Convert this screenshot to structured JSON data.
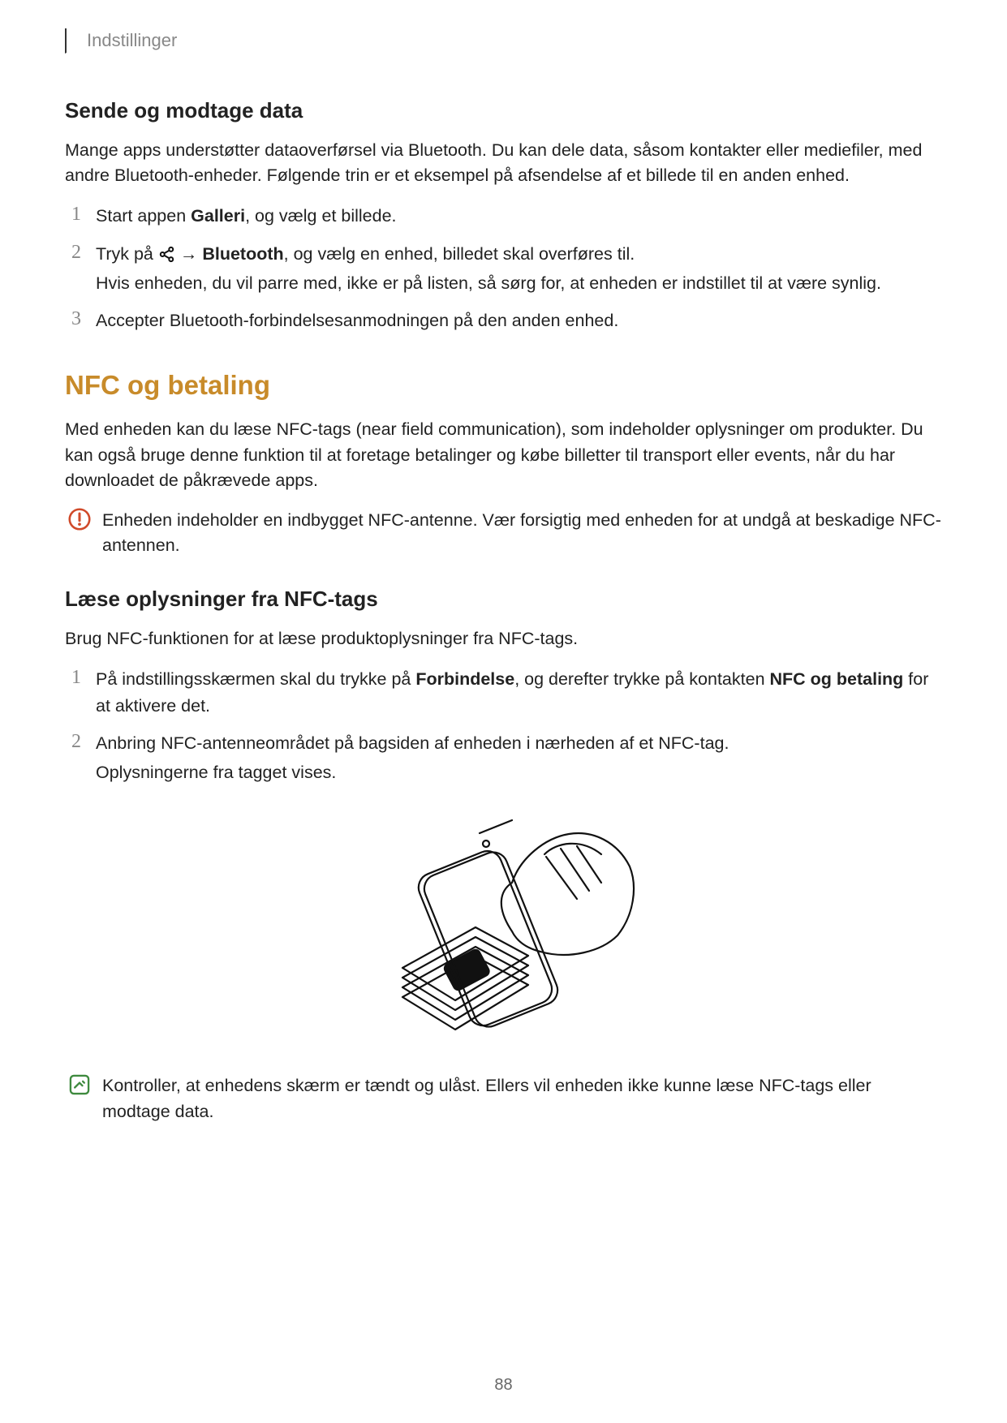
{
  "header": {
    "section": "Indstillinger"
  },
  "sect1": {
    "title": "Sende og modtage data",
    "intro": "Mange apps understøtter dataoverførsel via Bluetooth. Du kan dele data, såsom kontakter eller mediefiler, med andre Bluetooth-enheder. Følgende trin er et eksempel på afsendelse af et billede til en anden enhed.",
    "s1": {
      "num": "1",
      "a": "Start appen ",
      "b": "Galleri",
      "c": ", og vælg et billede."
    },
    "s2": {
      "num": "2",
      "a": "Tryk på ",
      "arrow": " → ",
      "b": "Bluetooth",
      "c": ", og vælg en enhed, billedet skal overføres til.",
      "d": "Hvis enheden, du vil parre med, ikke er på listen, så sørg for, at enheden er indstillet til at være synlig."
    },
    "s3": {
      "num": "3",
      "a": "Accepter Bluetooth-forbindelsesanmodningen på den anden enhed."
    }
  },
  "h2": "NFC og betaling",
  "nfc_intro": "Med enheden kan du læse NFC-tags (near field communication), som indeholder oplysninger om produkter. Du kan også bruge denne funktion til at foretage betalinger og købe billetter til transport eller events, når du har downloadet de påkrævede apps.",
  "warn": "Enheden indeholder en indbygget NFC-antenne. Vær forsigtig med enheden for at undgå at beskadige NFC-antennen.",
  "sect2": {
    "title": "Læse oplysninger fra NFC-tags",
    "intro": "Brug NFC-funktionen for at læse produktoplysninger fra NFC-tags.",
    "s1": {
      "num": "1",
      "a": "På indstillingsskærmen skal du trykke på ",
      "b": "Forbindelse",
      "c": ", og derefter trykke på kontakten ",
      "d": "NFC og betaling",
      "e": " for at aktivere det."
    },
    "s2": {
      "num": "2",
      "a": "Anbring NFC-antenneområdet på bagsiden af enheden i nærheden af et NFC-tag.",
      "b": "Oplysningerne fra tagget vises."
    }
  },
  "note": "Kontroller, at enhedens skærm er tændt og ulåst. Ellers vil enheden ikke kunne læse NFC-tags eller modtage data.",
  "page_num": "88"
}
